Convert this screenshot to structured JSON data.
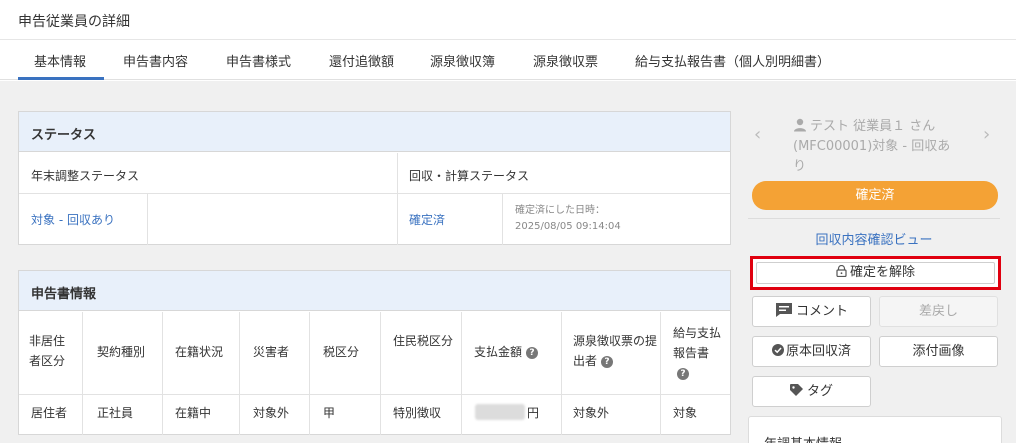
{
  "page": {
    "title": "申告従業員の詳細"
  },
  "tabs": [
    {
      "label": "基本情報",
      "active": true
    },
    {
      "label": "申告書内容"
    },
    {
      "label": "申告書様式"
    },
    {
      "label": "還付追徴額"
    },
    {
      "label": "源泉徴収簿"
    },
    {
      "label": "源泉徴収票"
    },
    {
      "label": "給与支払報告書（個人別明細書）"
    }
  ],
  "status_panel": {
    "heading": "ステータス",
    "col1_label": "年末調整ステータス",
    "col2_label": "回収・計算ステータス",
    "nenmatsu_value": "対象 - 回収あり",
    "kaishu_value": "確定済",
    "confirmed_at_label": "確定済にした日時：",
    "confirmed_at_value": "2025/08/05 09:14:04"
  },
  "shinkoku_panel": {
    "heading": "申告書情報",
    "headers": [
      "非居住者区分",
      "契約種別",
      "在籍状況",
      "災害者",
      "税区分",
      "住民税区分",
      "支払金額",
      "源泉徴収票の提出者",
      "給与支払報告書"
    ],
    "values": [
      "居住者",
      "正社員",
      "在籍中",
      "対象外",
      "甲",
      "特別徴収",
      "円",
      "対象外",
      "対象"
    ]
  },
  "sidebar": {
    "employee_name": "テスト 従業員１ さん",
    "employee_detail": "(MFC00001)対象 - 回収あり",
    "status_badge": "確定済",
    "review_link": "回収内容確認ビュー",
    "unlock_button": "確定を解除",
    "comment_button": "コメント",
    "return_button": "差戻し",
    "original_button": "原本回収済",
    "attachment_button": "添付画像",
    "tag_button": "タグ",
    "card_title": "年調基本情報"
  },
  "colors": {
    "accent": "#3a72c0",
    "status_orange": "#f4a235",
    "highlight_red": "#e0000f",
    "panel_header": "#e8f0fa"
  }
}
